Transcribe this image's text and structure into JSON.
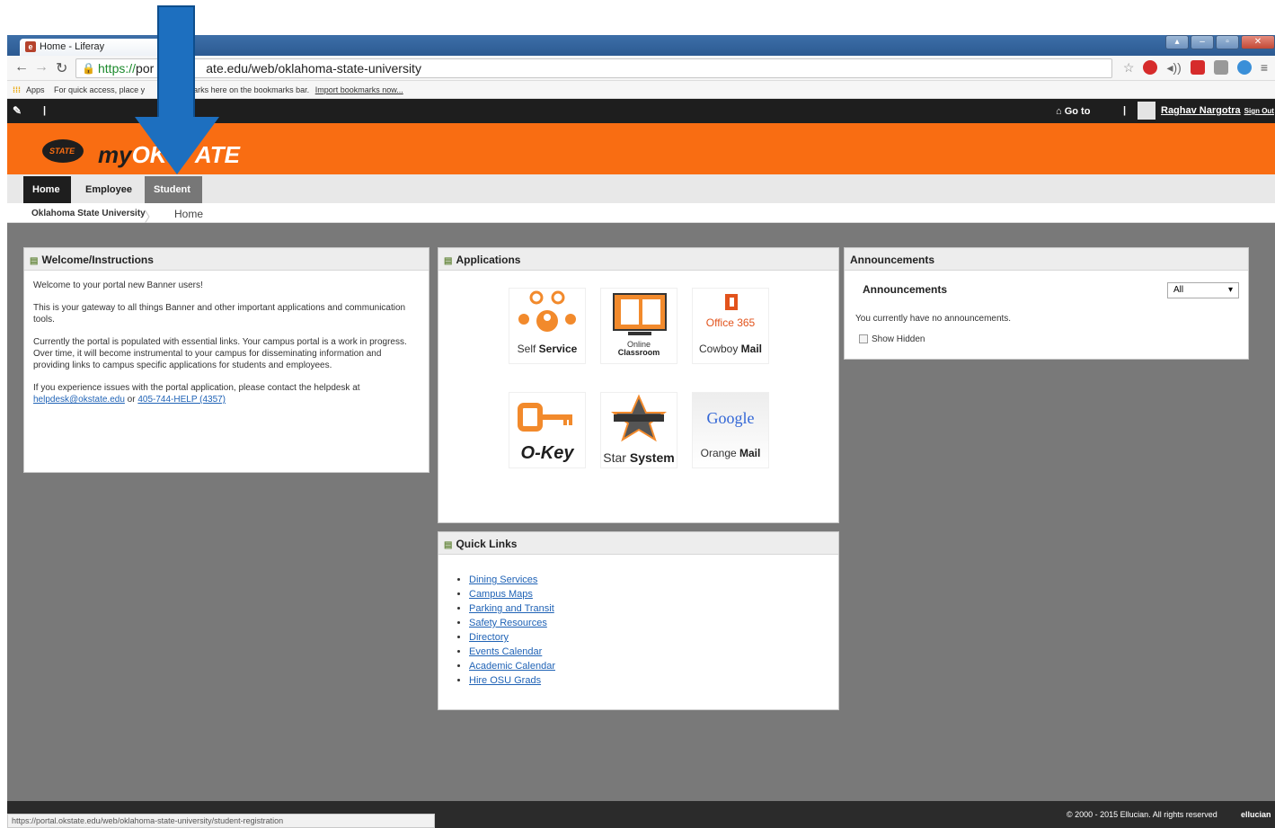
{
  "browser": {
    "tab_title": "Home - Liferay",
    "tab_close": "×",
    "address": {
      "scheme": "https://",
      "host_visible": "por",
      "rest_visible": "ate.edu/web/oklahoma-state-university"
    },
    "bookmarks": {
      "apps_label": "Apps",
      "hint_text": "For quick access, place y",
      "hint_tail": "marks here on the bookmarks bar.",
      "import_link": "Import bookmarks now..."
    },
    "status_url": "https://portal.okstate.edu/web/oklahoma-state-university/student-registration"
  },
  "topbar": {
    "separator": "|",
    "goto_label": "Go to",
    "user_name": "Raghav Nargotra",
    "sign_out": "Sign Out"
  },
  "brand": {
    "seal_text": "STATE",
    "logo_prefix": "my",
    "logo_main": "OKS",
    "logo_tail": "ATE"
  },
  "nav": {
    "tabs": [
      "Home",
      "Employee",
      "Student"
    ]
  },
  "breadcrumb": {
    "items": [
      "Oklahoma State University",
      "Home"
    ]
  },
  "welcome": {
    "title": "Welcome/Instructions",
    "p1": "Welcome to your portal new Banner users!",
    "p2": "This is your gateway to all things Banner and other important applications and communication tools.",
    "p3": "Currently the portal is populated with essential links.  Your campus portal is a work in progress.  Over time, it will become instrumental to your campus for disseminating information and providing links to campus specific applications for students and employees.",
    "p4": "If you experience issues with the portal application, please contact the helpdesk at",
    "email": "helpdesk@okstate.edu",
    "or": "or",
    "phone": "405-744-HELP (4357)"
  },
  "applications": {
    "title": "Applications",
    "tiles": [
      {
        "pre": "Self ",
        "bold": "Service"
      },
      {
        "pre": "Online",
        "bold": "Classroom"
      },
      {
        "pre": "Cowboy ",
        "bold": "Mail",
        "badge": "Office 365"
      },
      {
        "pre": "",
        "bold": "O-Key"
      },
      {
        "pre": "Star ",
        "bold": "System"
      },
      {
        "pre": "Orange ",
        "bold": "Mail",
        "badge": "Google"
      }
    ]
  },
  "quick_links": {
    "title": "Quick Links",
    "items": [
      "Dining Services",
      "Campus Maps",
      "Parking and Transit",
      "Safety Resources",
      "Directory",
      "Events Calendar",
      "Academic Calendar",
      "Hire OSU Grads"
    ]
  },
  "announcements": {
    "title": "Announcements",
    "subtitle": "Announcements",
    "filter_value": "All",
    "empty_text": "You currently have no announcements.",
    "show_hidden": "Show Hidden"
  },
  "footer": {
    "copyright": "© 2000 - 2015 Ellucian. All rights reserved",
    "vendor": "ellucian"
  },
  "colors": {
    "brand_orange": "#f96d12",
    "topbar_black": "#1e1e1e",
    "content_gray": "#797979",
    "link_blue": "#2063b6",
    "annotation_arrow": "#1d6fbf"
  }
}
